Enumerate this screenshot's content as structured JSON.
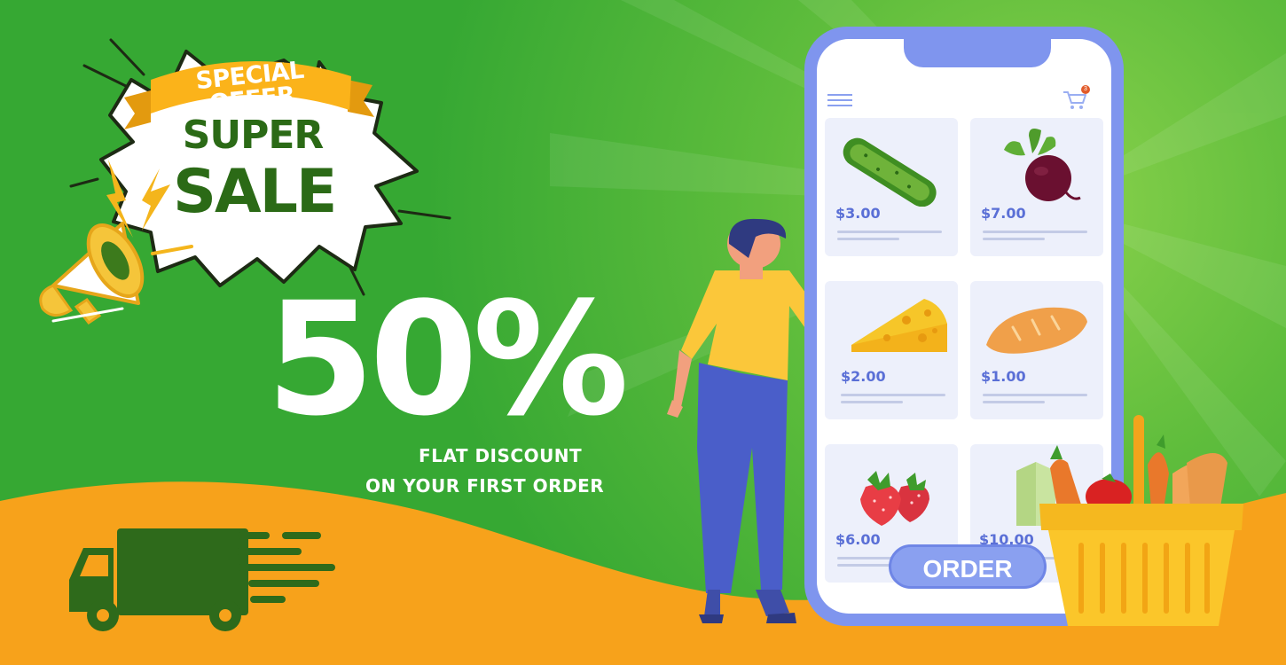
{
  "colors": {
    "green": "#3fae37",
    "orange": "#f7a21b",
    "white": "#ffffff",
    "dark_green": "#2b6a16",
    "phone_blue": "#7f95ee"
  },
  "badge": {
    "ribbon": "SPECIAL OFFER",
    "line1": "SUPER",
    "line2": "SALE"
  },
  "headline": {
    "percent": "50%",
    "line1": "FLAT DISCOUNT",
    "line2": "ON YOUR FIRST ORDER"
  },
  "phone": {
    "cart_count": "3",
    "products": [
      {
        "icon": "cucumber-icon",
        "price": "$3.00"
      },
      {
        "icon": "beetroot-icon",
        "price": "$7.00"
      },
      {
        "icon": "cheese-icon",
        "price": "$2.00"
      },
      {
        "icon": "bread-icon",
        "price": "$1.00"
      },
      {
        "icon": "strawberry-icon",
        "price": "$6.00"
      },
      {
        "icon": "milk-icon",
        "price": "$10.00"
      }
    ],
    "order_label": "ORDER"
  },
  "icons": [
    "megaphone-icon",
    "delivery-truck-icon",
    "shopping-basket-icon",
    "cart-icon",
    "menu-icon"
  ]
}
